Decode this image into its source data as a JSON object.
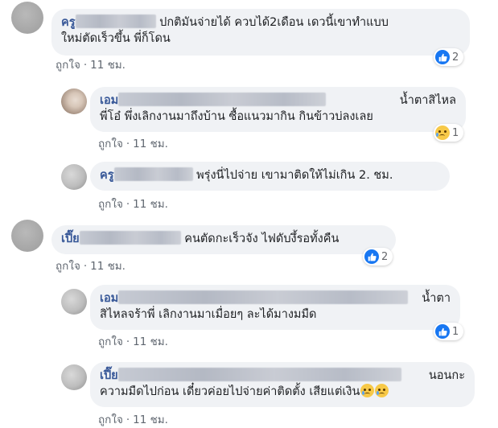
{
  "comments": [
    {
      "name_prefix": "ครู",
      "text_line1": "ปกติมันจ่ายได้ ควบได้2เดือน เดวนี้เขาทำแบบ",
      "text_line2": "ใหม่ตัดเร็วขึ้น พี่ก็โดน",
      "like_label": "ถูกใจ",
      "time": "11 ชม.",
      "reaction": "like",
      "reaction_count": "2"
    },
    {
      "name_prefix": "เอม",
      "text_line1_end": "น้ำตาสิไหล",
      "text_line2": "พี่โอ๋ พึ่งเลิกงานมาถึงบ้าน ซื้อแนวมากิน กินข้าวบ่ลงเลย",
      "like_label": "ถูกใจ",
      "time": "11 ชม.",
      "reaction": "sad",
      "reaction_count": "1"
    },
    {
      "name_prefix": "ครู",
      "text_line1": "พรุ่งนี่ไปจ่าย เขามาติดให้ไม่เกิน 2. ชม.",
      "like_label": "ถูกใจ",
      "time": "11 ชม."
    },
    {
      "name_prefix": "เปี๊ย",
      "text_line1": "คนตัดกะเร็วจัง ไฟดับงึ้รอทั้งคืน",
      "like_label": "ถูกใจ",
      "time": "11 ชม.",
      "reaction": "like",
      "reaction_count": "2"
    },
    {
      "name_prefix": "เอม",
      "text_line1_end": "น้ำตา",
      "text_line2": "สิไหลจร้าพี่ เลิกงานมาเมื่อยๆ ละได้มางมมืด",
      "like_label": "ถูกใจ",
      "time": "11 ชม.",
      "reaction": "like",
      "reaction_count": "1"
    },
    {
      "name_prefix": "เปี๊ย",
      "text_line1_end": "นอนกะ",
      "text_line2": "ความมืดไปก่อน เดี๋ยวค่อยไปจ่ายค่าติดตั้ง เสียแต่เงิน",
      "like_label": "ถูกใจ",
      "time": "11 ชม."
    }
  ],
  "colors": {
    "name": "#385898",
    "bubble": "#f0f2f5",
    "meta": "#606770",
    "like_blue": "#1877f2"
  }
}
